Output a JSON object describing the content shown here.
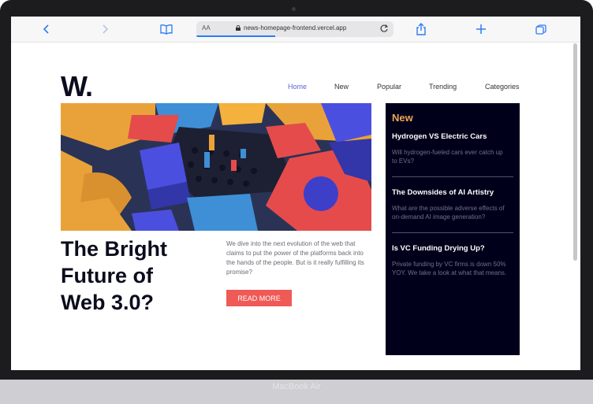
{
  "browser": {
    "url_aa": "AA",
    "url": "news-homepage-frontend.vercel.app",
    "icons": [
      "chevron-left-icon",
      "chevron-right-icon",
      "book-icon",
      "lock-icon",
      "reload-icon",
      "share-icon",
      "plus-icon",
      "tabs-icon"
    ]
  },
  "site": {
    "logo": "W.",
    "nav": [
      "Home",
      "New",
      "Popular",
      "Trending",
      "Categories"
    ],
    "accent": "#5b63d8"
  },
  "hero": {
    "headline": "The Bright Future of Web 3.0?",
    "description": "We dive into the next evolution of the web that claims to put the power of the platforms back into the hands of the people. But is it really fulfilling its promise?",
    "button": "READ MORE",
    "button_color": "#ef5a57"
  },
  "sidebar": {
    "title": "New",
    "title_color": "#f0a557",
    "items": [
      {
        "title": "Hydrogen VS Electric Cars",
        "line1": "Will hydrogen-fueled cars ever catch up",
        "line2": "to EVs?"
      },
      {
        "title": "The Downsides of AI Artistry",
        "line1": "What are the possible adverse effects of",
        "line2": "on-demand AI image generation?"
      },
      {
        "title": "Is VC Funding Drying Up?",
        "line1": "Private funding by VC firms is down 50%",
        "line2": "YOY. We take a look at what that means."
      }
    ]
  },
  "device": {
    "label": "MacBook Air"
  }
}
